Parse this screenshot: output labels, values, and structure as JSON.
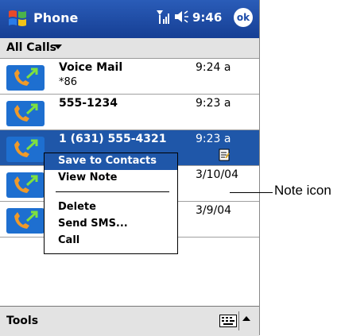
{
  "titlebar": {
    "app_title": "Phone",
    "clock": "9:46",
    "ok_label": "ok"
  },
  "filter": {
    "label": "All Calls"
  },
  "calls": [
    {
      "name": "Voice Mail",
      "sub": "*86",
      "time": "9:24 a"
    },
    {
      "name": "555-1234",
      "sub": "",
      "time": "9:23 a"
    },
    {
      "name": "1 (631) 555-4321",
      "sub": "",
      "time": "9:23 a"
    },
    {
      "name": "",
      "sub": "",
      "time": "3/10/04"
    },
    {
      "name": "",
      "sub": "",
      "time": "3/9/04"
    }
  ],
  "context_menu": {
    "items": [
      "Save to Contacts",
      "View Note",
      "Delete",
      "Send SMS...",
      "Call"
    ]
  },
  "commandbar": {
    "tools_label": "Tools"
  },
  "annotation": {
    "label": "Note icon"
  },
  "colors": {
    "titlebar": "#1f4ea3",
    "selection": "#1f57a9",
    "bar_bg": "#e3e3e3"
  }
}
